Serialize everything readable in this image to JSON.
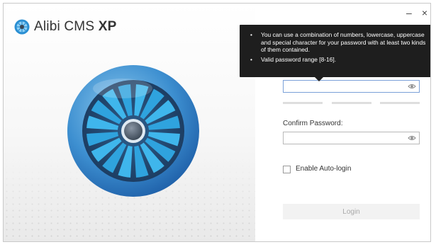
{
  "app": {
    "name_regular": "Alibi CMS",
    "name_bold": "XP"
  },
  "window_controls": {
    "minimize": "–",
    "close": "×"
  },
  "tooltip": {
    "items": [
      "You can use a combination of numbers, lowercase, uppercase and special character for your password with at least two kinds of them contained.",
      "Valid password range [8-16]."
    ]
  },
  "form": {
    "password_value": "",
    "confirm_label": "Confirm Password:",
    "confirm_value": "",
    "auto_login_label": "Enable Auto-login",
    "auto_login_checked": false,
    "login_label": "Login"
  },
  "colors": {
    "brand_blue": "#2a8fd3",
    "tooltip_bg": "#1e1e1e",
    "input_focus_border": "#7aa0d8"
  }
}
